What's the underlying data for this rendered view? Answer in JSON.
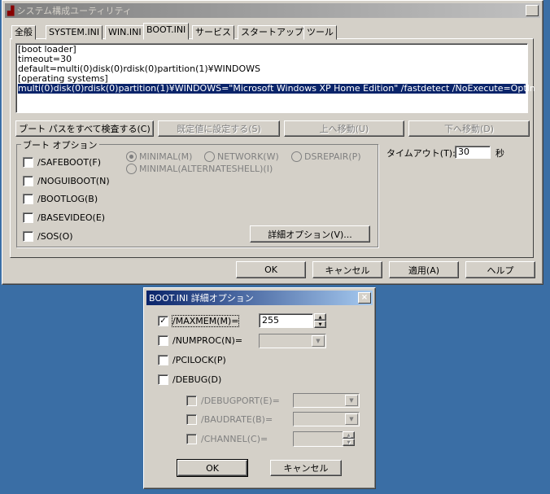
{
  "main": {
    "title": "システム構成ユーティリティ",
    "tabs": [
      "全般",
      "SYSTEM.INI",
      "WIN.INI",
      "BOOT.INI",
      "サービス",
      "スタートアップ",
      "ツール"
    ],
    "active_tab": "BOOT.INI",
    "bootini_lines": [
      "[boot loader]",
      "timeout=30",
      "default=multi(0)disk(0)rdisk(0)partition(1)¥WINDOWS",
      "[operating systems]",
      "multi(0)disk(0)rdisk(0)partition(1)¥WINDOWS=\"Microsoft Windows XP Home Edition\" /fastdetect /NoExecute=OptIn"
    ],
    "buttons": {
      "check": "ブート パスをすべて検査する(C)",
      "default": "既定値に設定する(S)",
      "up": "上へ移動(U)",
      "down": "下へ移動(D)",
      "advanced": "詳細オプション(V)..."
    },
    "boot_options": {
      "label": "ブート オプション",
      "checkboxes": [
        "/SAFEBOOT(F)",
        "/NOGUIBOOT(N)",
        "/BOOTLOG(B)",
        "/BASEVIDEO(E)",
        "/SOS(O)"
      ],
      "radios": [
        "MINIMAL(M)",
        "NETWORK(W)",
        "DSREPAIR(P)",
        "MINIMAL(ALTERNATESHELL)(I)"
      ]
    },
    "timeout": {
      "label": "タイムアウト(T):",
      "value": "30",
      "unit": "秒"
    },
    "footer": {
      "ok": "OK",
      "cancel": "キャンセル",
      "apply": "適用(A)",
      "help": "ヘルプ"
    }
  },
  "dialog": {
    "title": "BOOT.INI 詳細オプション",
    "maxmem": {
      "label": "/MAXMEM(M)=",
      "value": "255",
      "checked": true
    },
    "numproc": "/NUMPROC(N)=",
    "pcilock": "/PCILOCK(P)",
    "debug": "/DEBUG(D)",
    "debugport": "/DEBUGPORT(E)=",
    "baudrate": "/BAUDRATE(B)=",
    "channel": "/CHANNEL(C)=",
    "ok": "OK",
    "cancel": "キャンセル"
  },
  "icons": {
    "check": "✓",
    "close": "×",
    "up": "▲",
    "down": "▼"
  }
}
